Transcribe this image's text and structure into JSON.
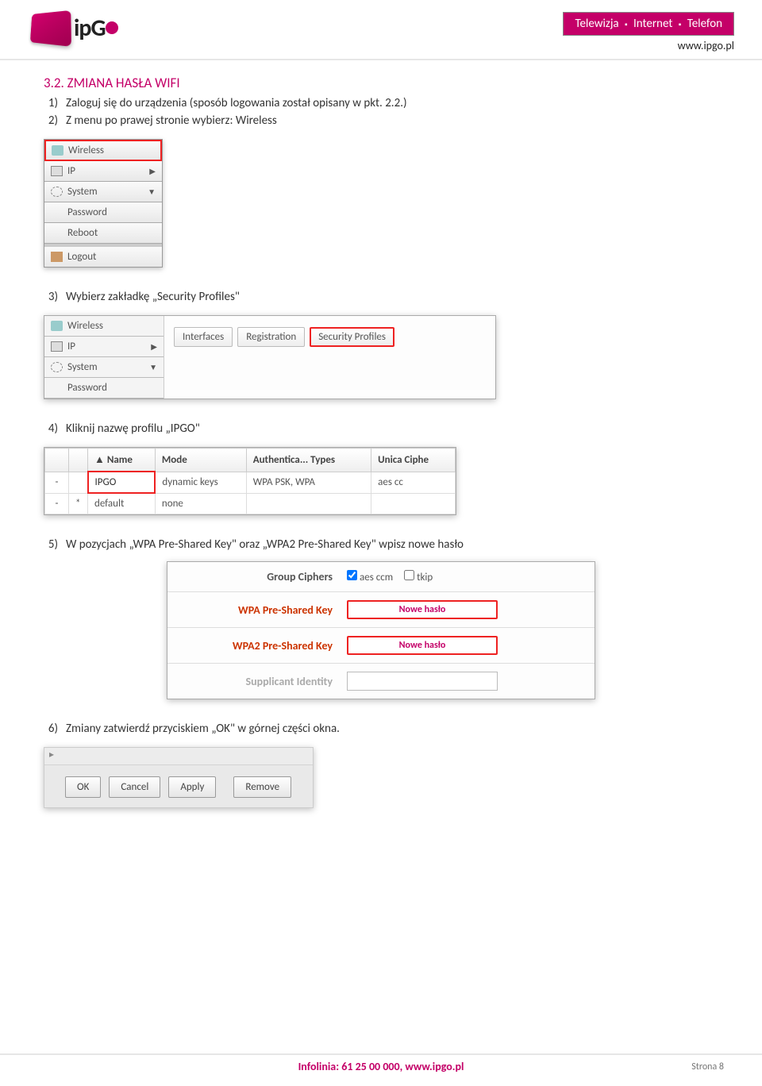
{
  "header": {
    "logo_text": "ipGo",
    "badge_tv": "Telewizja",
    "badge_net": "Internet",
    "badge_tel": "Telefon",
    "www": "www.ipgo.pl"
  },
  "section": {
    "title": "3.2. ZMIANA HASŁA WIFI",
    "step1_num": "1)",
    "step1": "Zaloguj się do urządzenia (sposób logowania został opisany w pkt. 2.2.)",
    "step2_num": "2)",
    "step2": "Z menu po prawej stronie wybierz: Wireless",
    "step3_num": "3)",
    "step3": "Wybierz zakładkę „Security Profiles\"",
    "step4_num": "4)",
    "step4": "Kliknij nazwę profilu „IPGO\"",
    "step5_num": "5)",
    "step5": "W pozycjach „WPA Pre-Shared Key\" oraz „WPA2 Pre-Shared Key\" wpisz nowe hasło",
    "step6_num": "6)",
    "step6": "Zmiany zatwierdź przyciskiem „OK\" w górnej części okna."
  },
  "sidebar": {
    "wireless": "Wireless",
    "ip": "IP",
    "system": "System",
    "password": "Password",
    "reboot": "Reboot",
    "logout": "Logout"
  },
  "tabs": {
    "interfaces": "Interfaces",
    "registration": "Registration",
    "security": "Security Profiles"
  },
  "profiles": {
    "h_name": "Name",
    "h_mode": "Mode",
    "h_auth": "Authentica... Types",
    "h_ciph": "Unica Ciphe",
    "rows": [
      {
        "name": "IPGO",
        "mode": "dynamic keys",
        "auth": "WPA PSK, WPA",
        "ciph": "aes cc"
      },
      {
        "name": "default",
        "mode": "none",
        "auth": "",
        "ciph": ""
      }
    ]
  },
  "ciphers": {
    "group": "Group Ciphers",
    "aes": "aes ccm",
    "tkip": "tkip",
    "wpa": "WPA Pre-Shared Key",
    "wpa2": "WPA2 Pre-Shared Key",
    "supp": "Supplicant Identity",
    "new_pwd": "Nowe hasło"
  },
  "okbar": {
    "ok": "OK",
    "cancel": "Cancel",
    "apply": "Apply",
    "remove": "Remove"
  },
  "footer": {
    "info": "Infolinia: 61 25 00 000, www.ipgo.pl",
    "page": "Strona 8"
  }
}
